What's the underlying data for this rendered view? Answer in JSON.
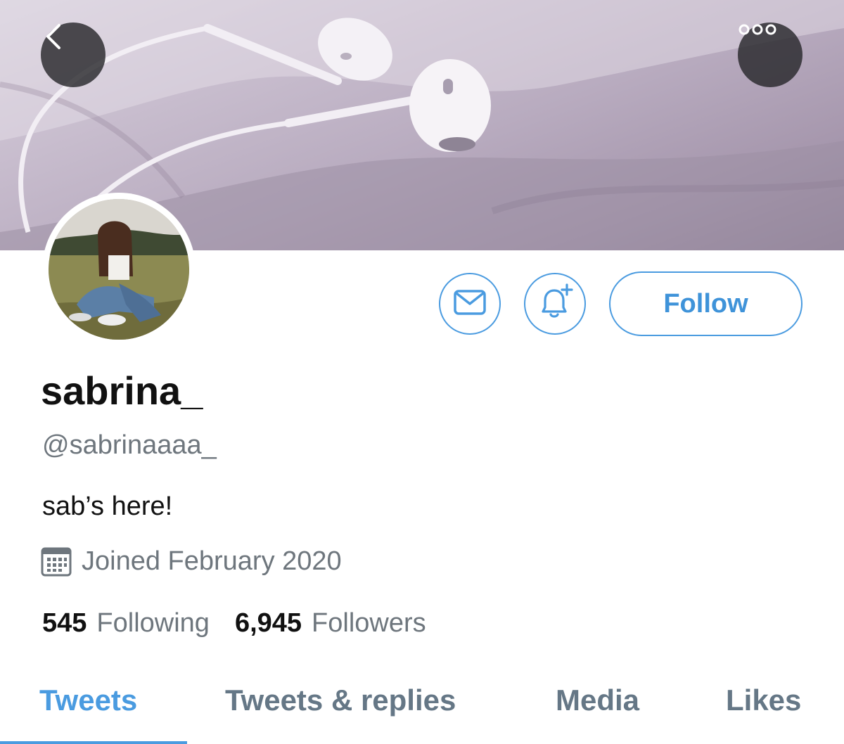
{
  "header": {
    "back_icon": "chevron-left-icon",
    "more_icon": "more-horizontal-icon"
  },
  "actions": {
    "message_icon": "mail-icon",
    "notify_icon": "bell-plus-icon",
    "follow_label": "Follow"
  },
  "profile": {
    "display_name": "sabrina_",
    "handle": "@sabrinaaaa_",
    "bio": "sab’s here!",
    "joined": "Joined February 2020",
    "joined_icon": "calendar-icon"
  },
  "stats": {
    "following_count": "545",
    "following_label": "Following",
    "followers_count": "6,945",
    "followers_label": "Followers"
  },
  "tabs": [
    {
      "label": "Tweets",
      "active": true
    },
    {
      "label": "Tweets & replies",
      "active": false
    },
    {
      "label": "Media",
      "active": false
    },
    {
      "label": "Likes",
      "active": false
    }
  ],
  "colors": {
    "accent": "#4a9be0",
    "secondary_text": "#6e767d",
    "primary_text": "#111111"
  }
}
